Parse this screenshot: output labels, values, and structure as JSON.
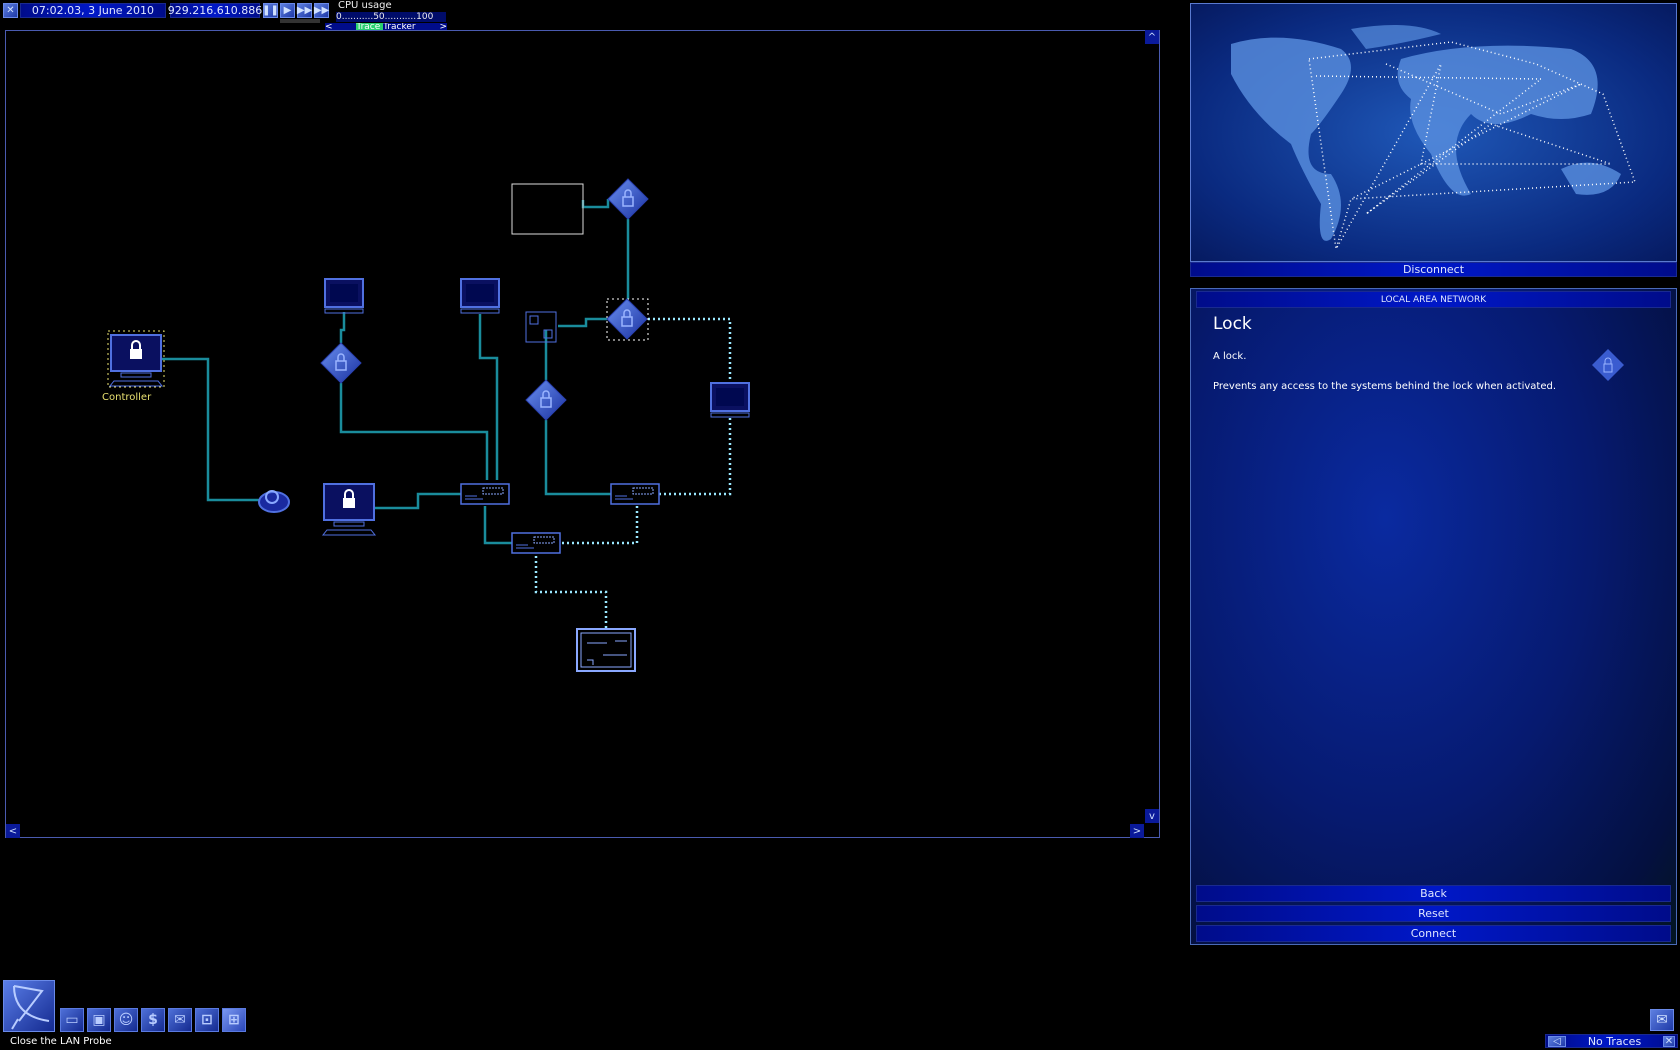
{
  "topbar": {
    "date": "07:02.03, 3 June 2010",
    "ip": "929.216.610.886",
    "cpu_label": "CPU usage",
    "cpu_scale": "0...........50...........100",
    "tracker_label": "Trace Tracker",
    "tracker_prev": "<",
    "tracker_next": ">",
    "speed_buttons": [
      "pause",
      "play",
      "fast",
      "fastest"
    ]
  },
  "lan": {
    "controller_label": "Controller",
    "scroll_up": "^",
    "scroll_down": "v",
    "scroll_left": "<",
    "scroll_right": ">"
  },
  "map": {
    "disconnect_label": "Disconnect"
  },
  "panel": {
    "header": "LOCAL AREA NETWORK",
    "title": "Lock",
    "line1": "A lock.",
    "line2": "Prevents any access to the systems behind the lock when activated.",
    "back": "Back",
    "reset": "Reset",
    "connect": "Connect"
  },
  "bottom": {
    "status": "Close the LAN Probe",
    "traces": "No Traces",
    "tools": [
      "computer",
      "software",
      "person",
      "finance",
      "email",
      "lan-view",
      "lan-probe"
    ]
  },
  "colors": {
    "link": "#1a8c9c",
    "accent": "#0018c8",
    "controller": "#e8e070"
  }
}
